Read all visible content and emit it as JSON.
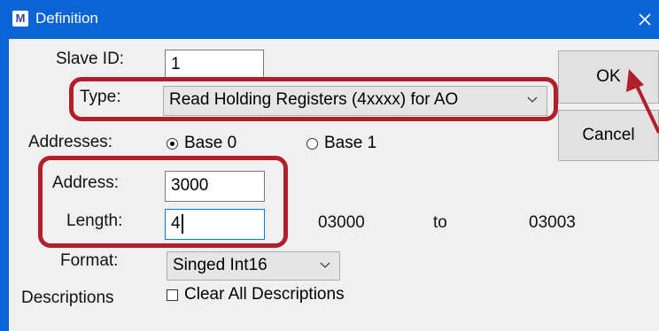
{
  "window": {
    "title": "Definition",
    "app_icon_letter": "M"
  },
  "form": {
    "slave_id": {
      "label": "Slave ID:",
      "value": "1"
    },
    "type": {
      "label": "Type:",
      "value": "Read Holding Registers (4xxxx) for AO"
    },
    "addresses": {
      "label": "Addresses:",
      "base0": "Base 0",
      "base1": "Base 1",
      "selected": "Base 0"
    },
    "address": {
      "label": "Address:",
      "value": "3000"
    },
    "length": {
      "label": "Length:",
      "value": "4"
    },
    "range": {
      "from": "03000",
      "to_word": "to",
      "to": "03003"
    },
    "format": {
      "label": "Format:",
      "value": "Singed Int16"
    },
    "descriptions": {
      "label": "Descriptions",
      "checkbox_label": "Clear All Descriptions",
      "checked": false
    }
  },
  "buttons": {
    "ok": "OK",
    "cancel": "Cancel"
  },
  "colors": {
    "titlebar": "#0a64d6",
    "highlight": "#b1202a",
    "client_bg": "#f0f0f0"
  }
}
